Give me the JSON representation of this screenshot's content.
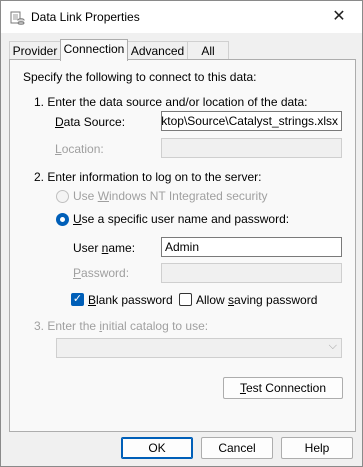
{
  "window": {
    "title": "Data Link Properties",
    "close_glyph": "✕"
  },
  "tabs": [
    {
      "label": "Provider",
      "active": false
    },
    {
      "label": "Connection",
      "active": true
    },
    {
      "label": "Advanced",
      "active": false
    },
    {
      "label": "All",
      "active": false
    }
  ],
  "connection": {
    "intro": "Specify the following to connect to this data:",
    "step1": "1. Enter the data source and/or location of the data:",
    "data_source_label": "Data Source:",
    "data_source_value": "Desktop\\Source\\Catalyst_strings.xlsx",
    "location_label": "Location:",
    "location_value": "",
    "step2": "2. Enter information to log on to the server:",
    "radio_windows_nt": "Use Windows NT Integrated security",
    "radio_specific": "Use a specific user name and password:",
    "user_name_label": "User name:",
    "user_name_value": "Admin",
    "password_label": "Password:",
    "password_value": "",
    "blank_password_label": "Blank password",
    "blank_password_checked": true,
    "allow_saving_label": "Allow saving password",
    "allow_saving_checked": false,
    "step3": "3. Enter the initial catalog to use:",
    "catalog_value": "",
    "test_connection_label": "Test Connection"
  },
  "footer": {
    "ok_label": "OK",
    "cancel_label": "Cancel",
    "help_label": "Help"
  },
  "icons": {
    "window_icon": "data-link-icon",
    "combo_arrow": "chevron-down-icon"
  },
  "colors": {
    "accent": "#005fb8",
    "disabled_text": "#a0a0a0"
  }
}
